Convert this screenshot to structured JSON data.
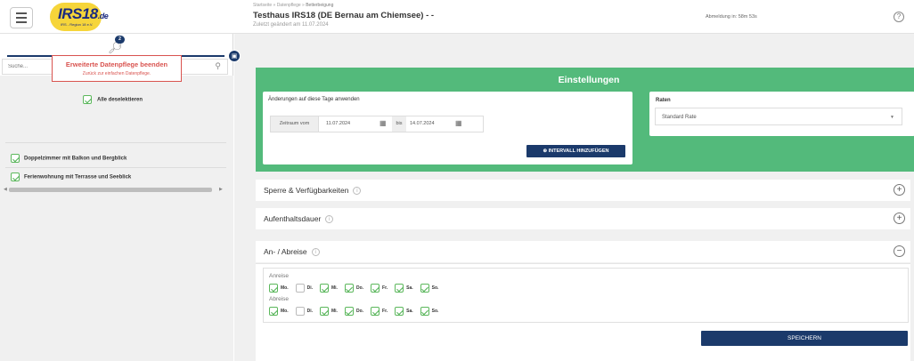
{
  "header": {
    "logo_main": "IRS18",
    "logo_suffix": ".de",
    "logo_tagline": "IRS - Region 18 e.V.",
    "breadcrumb": [
      "Startseite",
      "Datenpflege",
      "Betterbeigung"
    ],
    "breadcrumb_sep": "»",
    "title": "Testhaus IRS18 (DE Bernau am Chiemsee) - -",
    "subtitle": "Zuletzt geändert am 11.07.2024",
    "logout_timer": "Abmeldung in: 58m 53s",
    "help_glyph": "?"
  },
  "sidebar": {
    "notification_count": "2",
    "search_placeholder": "Suche...",
    "extended_button": {
      "label": "Erweiterte Datenpflege beenden",
      "sublabel": "Zurück zur einfachen Datenpflege."
    },
    "deselect_all": "Alle deselektieren",
    "rooms": [
      {
        "label": "Doppelzimmer mit Balkon und Bergblick",
        "checked": true
      },
      {
        "label": "Ferienwohnung mit Terrasse und Seeblick",
        "checked": true
      }
    ]
  },
  "settings": {
    "title": "Einstellungen",
    "apply_label": "Änderungen auf diese Tage anwenden",
    "range_from_label": "Zeitraum vom",
    "date_from": "11.07.2024",
    "range_to_label": "bis",
    "date_to": "14.07.2024",
    "add_interval": "⊕ INTERVALL HINZUFÜGEN",
    "rates_label": "Raten",
    "rate_selected": "Standard Rate"
  },
  "panels": [
    {
      "title": "Sperre & Verfügbarkeiten",
      "toggle": "+"
    },
    {
      "title": "Aufenthaltsdauer",
      "toggle": "+"
    },
    {
      "title": "An- / Abreise",
      "toggle": "−"
    }
  ],
  "an_abreise": {
    "anreise_label": "Anreise",
    "abreise_label": "Abreise",
    "days": [
      {
        "label": "Mo.",
        "anreise": true,
        "abreise": true
      },
      {
        "label": "Di.",
        "anreise": false,
        "abreise": false
      },
      {
        "label": "Mi.",
        "anreise": true,
        "abreise": true
      },
      {
        "label": "Do.",
        "anreise": true,
        "abreise": true
      },
      {
        "label": "Fr.",
        "anreise": true,
        "abreise": true
      },
      {
        "label": "Sa.",
        "anreise": true,
        "abreise": true
      },
      {
        "label": "So.",
        "anreise": true,
        "abreise": true
      }
    ]
  },
  "save_label": "SPEICHERN",
  "colors": {
    "primary": "#1b3a6b",
    "settings_bg": "#53ba7b",
    "danger": "#d9534f",
    "logo_yellow": "#f6d53a",
    "check_green": "#4caf50"
  }
}
